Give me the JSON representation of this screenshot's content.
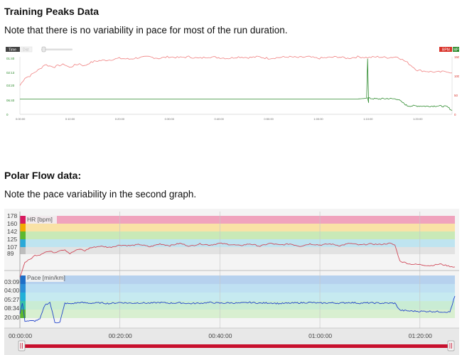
{
  "tp_section": {
    "heading": "Training Peaks Data",
    "note": "Note that there is no variability in pace for most of the run duration."
  },
  "tp_chart": {
    "toolbar": {
      "time_label": "Time",
      "dist_label": "Dist",
      "bpm_label": "BPM",
      "pace_label": "MP"
    },
    "left_ticks": [
      "0",
      "06:40",
      "03:20",
      "02:13",
      "01:40"
    ],
    "right_ticks": [
      "0",
      "50",
      "100",
      "150"
    ],
    "x_ticks": [
      "0:00:00",
      "0:10:00",
      "0:20:00",
      "0:30:00",
      "0:40:00",
      "0:50:00",
      "1:00:00",
      "1:10:00",
      "1:20:00"
    ],
    "colors": {
      "hr": "#f08080",
      "pace": "#2e8b2e",
      "time_btn": "#444444"
    }
  },
  "pf_section": {
    "heading": "Polar Flow data:",
    "note": "Note the pace variability in the second graph."
  },
  "pf_chart": {
    "hr_label": "HR [bpm]",
    "pace_label": "Pace [min/km]",
    "hr_ticks": [
      "178",
      "160",
      "142",
      "125",
      "107",
      "89"
    ],
    "pace_ticks": [
      "03:09",
      "04:00",
      "05:27",
      "08:34",
      "20:00"
    ],
    "x_ticks": [
      "00:00:00",
      "00:20:00",
      "00:40:00",
      "01:00:00",
      "01:20:00"
    ],
    "colors": {
      "hr_line": "#d04a5a",
      "pace_line": "#2244cc",
      "scrubber": "#c8102e"
    }
  },
  "chart_data": [
    {
      "type": "line",
      "name": "tp",
      "x_minutes": [
        0,
        1,
        2,
        3,
        4,
        5,
        6,
        7,
        8,
        9,
        10,
        11,
        12,
        13,
        14,
        15,
        16,
        18,
        20,
        22,
        24,
        26,
        28,
        30,
        32,
        34,
        36,
        38,
        40,
        42,
        44,
        46,
        48,
        50,
        52,
        54,
        56,
        58,
        60,
        62,
        64,
        66,
        68,
        70,
        72,
        74,
        76,
        78,
        80,
        82,
        84,
        86,
        87
      ],
      "series": [
        {
          "axis": "right",
          "values": [
            75,
            95,
            100,
            110,
            118,
            130,
            126,
            124,
            128,
            130,
            122,
            128,
            132,
            126,
            134,
            138,
            140,
            142,
            146,
            144,
            148,
            150,
            146,
            150,
            148,
            150,
            146,
            150,
            148,
            146,
            150,
            148,
            150,
            146,
            148,
            150,
            148,
            150,
            146,
            148,
            150,
            146,
            150,
            148,
            150,
            148,
            150,
            135,
            115,
            112,
            110,
            112,
            108
          ]
        },
        {
          "axis": "right",
          "values": [
            40,
            40,
            40,
            40,
            40,
            40,
            40,
            40,
            40,
            40,
            40,
            40,
            40,
            40,
            40,
            40,
            40,
            40,
            40,
            40,
            40,
            40,
            40,
            40,
            40,
            40,
            40,
            40,
            40,
            40,
            40,
            40,
            40,
            40,
            40,
            40,
            40,
            40,
            40,
            40,
            40,
            40,
            40,
            42,
            40,
            41,
            40,
            22,
            22,
            21,
            22,
            20,
            10
          ]
        }
      ]
    },
    {
      "type": "line",
      "name": "pf-hr",
      "x_minutes": [
        0,
        1,
        2,
        3,
        4,
        5,
        6,
        7,
        8,
        9,
        10,
        11,
        12,
        13,
        14,
        16,
        18,
        20,
        22,
        24,
        26,
        28,
        30,
        32,
        34,
        36,
        38,
        40,
        42,
        44,
        46,
        48,
        50,
        52,
        54,
        56,
        58,
        60,
        62,
        64,
        66,
        68,
        70,
        72,
        74,
        75,
        76,
        78,
        80,
        82,
        84,
        86,
        87
      ],
      "values": [
        72,
        98,
        103,
        110,
        111,
        116,
        117,
        115,
        119,
        120,
        113,
        118,
        121,
        118,
        123,
        126,
        124,
        128,
        127,
        129,
        125,
        130,
        127,
        131,
        126,
        130,
        128,
        131,
        129,
        127,
        130,
        126,
        131,
        128,
        130,
        126,
        130,
        128,
        130,
        127,
        131,
        128,
        130,
        129,
        131,
        128,
        100,
        95,
        94,
        92,
        95,
        91,
        90
      ],
      "ylim": [
        80,
        185
      ]
    },
    {
      "type": "line",
      "name": "pf-pace",
      "x_minutes": [
        0,
        0.5,
        1,
        2,
        3,
        4,
        5,
        6,
        7,
        8,
        9,
        10,
        11,
        12,
        14,
        16,
        18,
        20,
        22,
        24,
        26,
        28,
        30,
        32,
        34,
        36,
        38,
        40,
        42,
        44,
        46,
        48,
        50,
        52,
        54,
        56,
        58,
        60,
        62,
        64,
        66,
        68,
        70,
        72,
        74,
        75,
        76,
        78,
        80,
        82,
        84,
        86,
        87
      ],
      "values": [
        0.3,
        0.6,
        0.1,
        0.1,
        0.1,
        0.15,
        0.55,
        0.62,
        0.06,
        0.06,
        0.6,
        0.58,
        0.6,
        0.62,
        0.6,
        0.61,
        0.59,
        0.62,
        0.6,
        0.61,
        0.6,
        0.62,
        0.6,
        0.61,
        0.59,
        0.6,
        0.62,
        0.6,
        0.61,
        0.6,
        0.62,
        0.6,
        0.61,
        0.59,
        0.6,
        0.61,
        0.62,
        0.6,
        0.61,
        0.6,
        0.62,
        0.6,
        0.61,
        0.6,
        0.6,
        0.6,
        0.4,
        0.38,
        0.37,
        0.37,
        0.36,
        0.35,
        0.8
      ]
    }
  ]
}
